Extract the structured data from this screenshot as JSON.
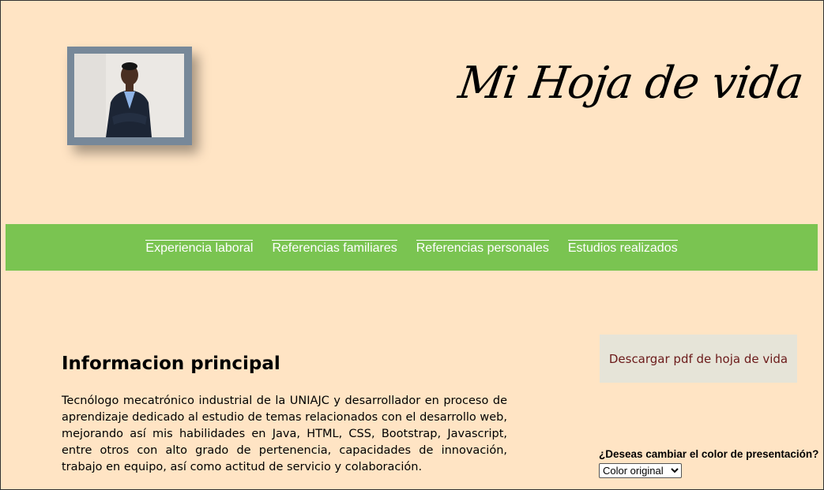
{
  "header": {
    "title": "Mi Hoja de vida"
  },
  "nav": {
    "items": [
      {
        "label": "Experiencia laboral"
      },
      {
        "label": "Referencias familiares"
      },
      {
        "label": "Referencias personales"
      },
      {
        "label": "Estudios realizados"
      }
    ]
  },
  "main": {
    "title": "Informacion principal",
    "text": "Tecnólogo mecatrónico industrial de la UNIAJC y desarrollador en proceso de aprendizaje dedicado al estudio de temas relacionados con el desarrollo web, mejorando así mis habilidades en Java, HTML, CSS, Bootstrap, Javascript, entre otros con alto grado de pertenencia, capacidades de innovación, trabajo en equipo, así como actitud de servicio y colaboración."
  },
  "sidebar": {
    "download_label": "Descargar pdf de hoja de vida",
    "color_question": "¿Deseas cambiar el color de presentación?",
    "color_selected": "Color original"
  },
  "colors": {
    "background": "#ffe4c4",
    "navbar": "#7ac451",
    "photo_frame": "#778899",
    "download_bg": "#e6e4d8",
    "download_text": "#6b1a1a"
  }
}
